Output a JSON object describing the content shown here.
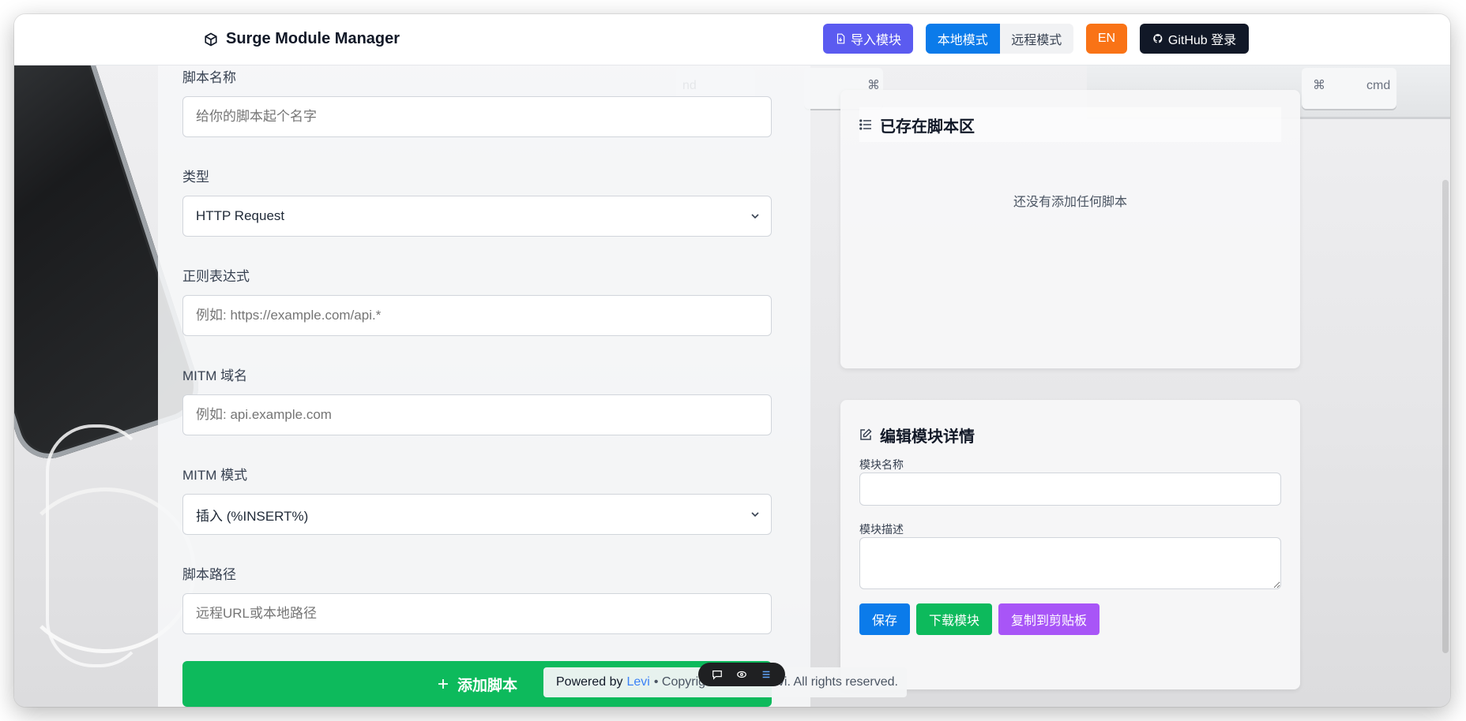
{
  "header": {
    "brand": "Surge Module Manager",
    "import_label": "导入模块",
    "mode_local": "本地模式",
    "mode_remote": "远程模式",
    "lang_label": "EN",
    "github_label": "GitHub 登录"
  },
  "form": {
    "name_label": "脚本名称",
    "name_placeholder": "给你的脚本起个名字",
    "type_label": "类型",
    "type_value": "HTTP Request",
    "regex_label": "正则表达式",
    "regex_placeholder": "例如: https://example.com/api.*",
    "mitm_label": "MITM 域名",
    "mitm_placeholder": "例如: api.example.com",
    "mitm_mode_label": "MITM 模式",
    "mitm_mode_value": "插入 (%INSERT%)",
    "path_label": "脚本路径",
    "path_placeholder": "远程URL或本地路径",
    "add_label": "添加脚本"
  },
  "scripts_card": {
    "title": "已存在脚本区",
    "empty_text": "还没有添加任何脚本"
  },
  "detail_card": {
    "title": "编辑模块详情",
    "name_label": "模块名称",
    "desc_label": "模块描述",
    "save_label": "保存",
    "download_label": "下载模块",
    "copy_label": "复制到剪贴板"
  },
  "footer": {
    "powered": "Powered by",
    "author": "Levi",
    "copyright": "• Copyright © 2025 Levi. All rights reserved."
  },
  "background_keys": {
    "cmd_left": "nd",
    "symbol_left": "⌘",
    "symbol_right": "⌘",
    "cmd_right": "cmd"
  },
  "colors": {
    "import": "#5b5bf0",
    "local_active": "#0b7bea",
    "lang": "#f97316",
    "github": "#111827",
    "add": "#0dba5c",
    "save": "#0b7bea",
    "download": "#0dba5c",
    "copy": "#a855f7"
  }
}
